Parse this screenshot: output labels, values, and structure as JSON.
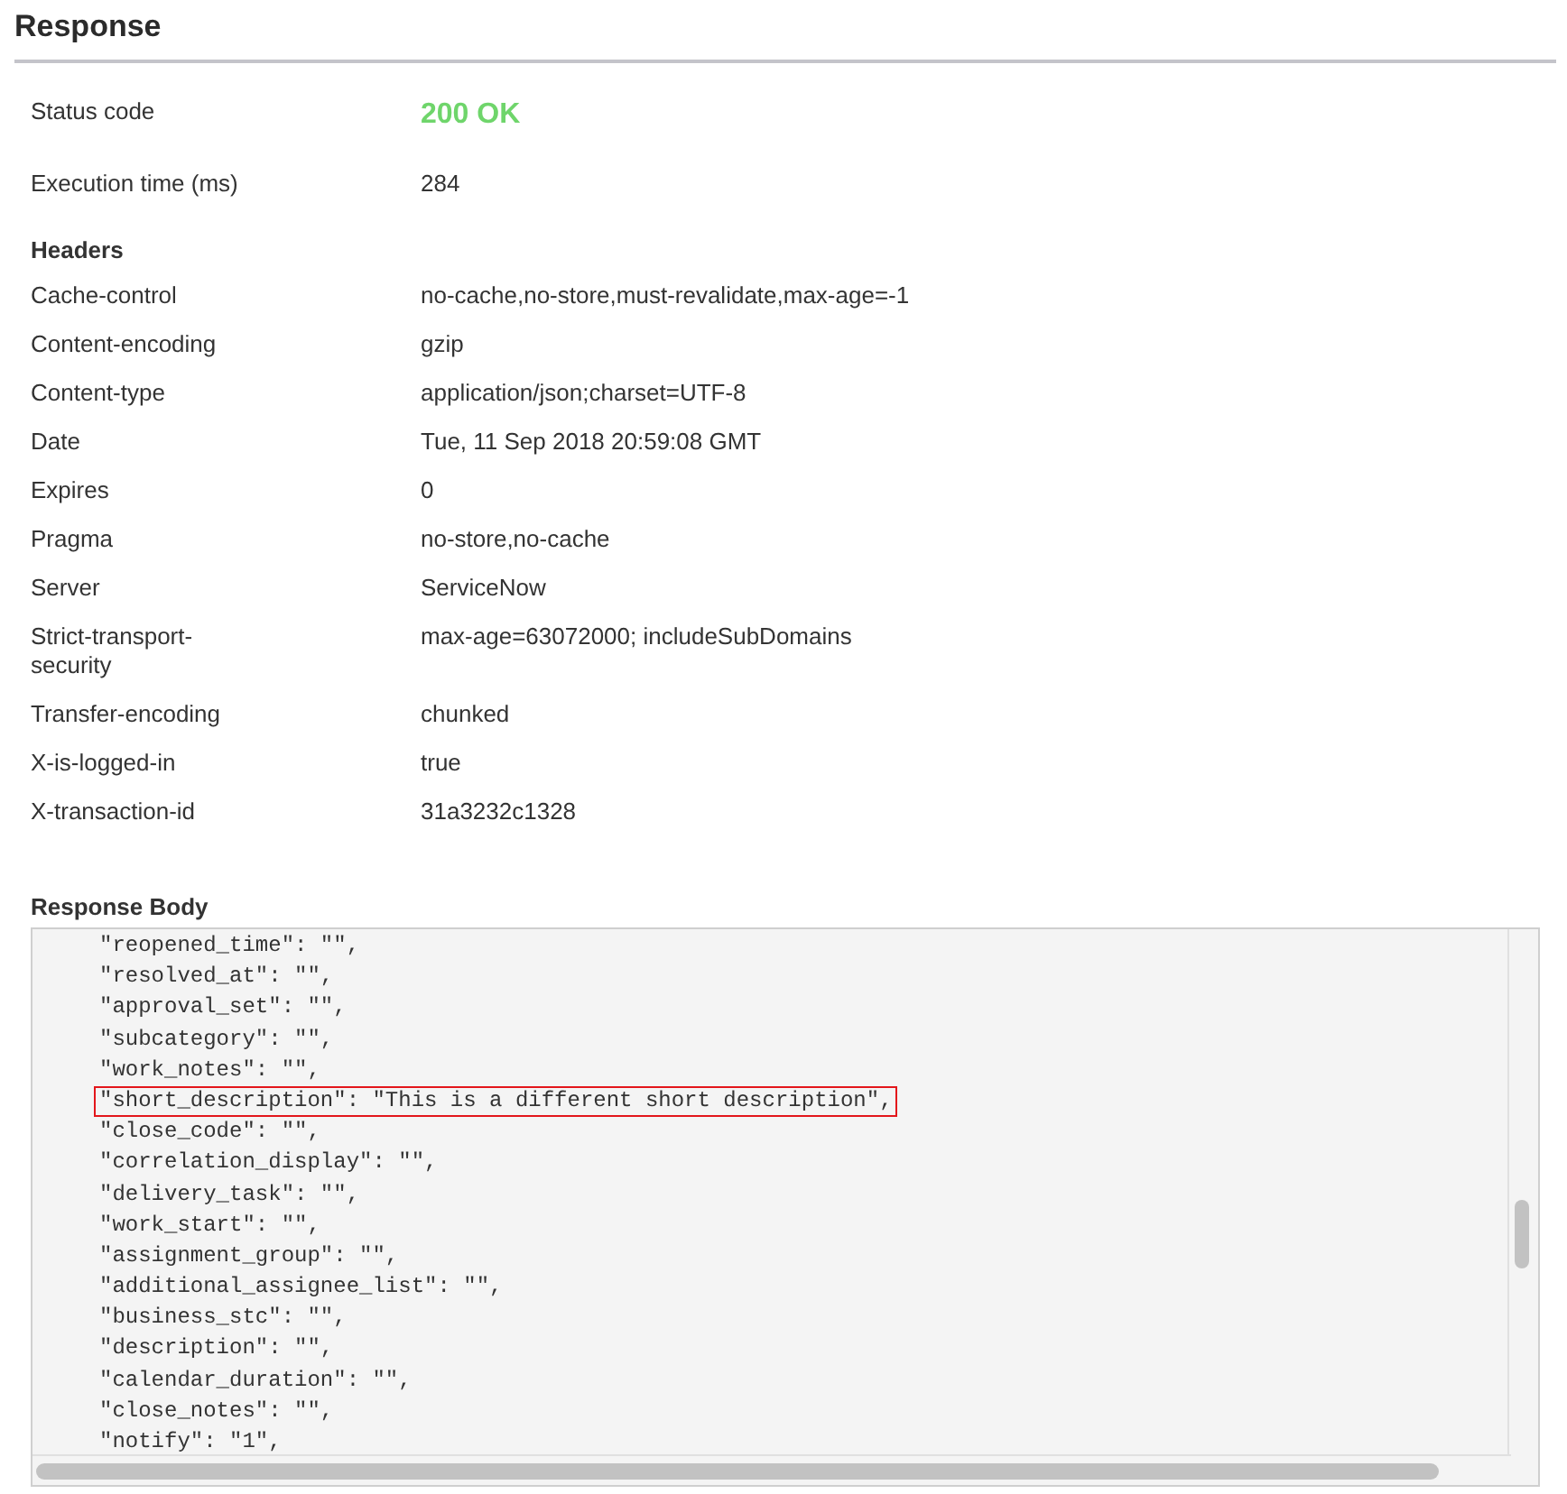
{
  "title": "Response",
  "summary": [
    {
      "label": "Status code",
      "value": "200 OK",
      "kind": "status"
    },
    {
      "label": "Execution time (ms)",
      "value": "284",
      "kind": "plain"
    }
  ],
  "headers_title": "Headers",
  "headers": [
    {
      "name": "Cache-control",
      "value": "no-cache,no-store,must-revalidate,max-age=-1"
    },
    {
      "name": "Content-encoding",
      "value": "gzip"
    },
    {
      "name": "Content-type",
      "value": "application/json;charset=UTF-8"
    },
    {
      "name": "Date",
      "value": "Tue, 11 Sep 2018 20:59:08 GMT"
    },
    {
      "name": "Expires",
      "value": "0"
    },
    {
      "name": "Pragma",
      "value": "no-store,no-cache"
    },
    {
      "name": "Server",
      "value": "ServiceNow"
    },
    {
      "name": "Strict-transport-security",
      "value": "max-age=63072000; includeSubDomains"
    },
    {
      "name": "Transfer-encoding",
      "value": "chunked"
    },
    {
      "name": "X-is-logged-in",
      "value": "true"
    },
    {
      "name": "X-transaction-id",
      "value": "31a3232c1328"
    }
  ],
  "body_title": "Response Body",
  "body_lines": [
    {
      "text": "\"reopened_time\": \"\",",
      "highlighted": false
    },
    {
      "text": "\"resolved_at\": \"\",",
      "highlighted": false
    },
    {
      "text": "\"approval_set\": \"\",",
      "highlighted": false
    },
    {
      "text": "\"subcategory\": \"\",",
      "highlighted": false
    },
    {
      "text": "\"work_notes\": \"\",",
      "highlighted": false
    },
    {
      "text": "\"short_description\": \"This is a different short description\",",
      "highlighted": true
    },
    {
      "text": "\"close_code\": \"\",",
      "highlighted": false
    },
    {
      "text": "\"correlation_display\": \"\",",
      "highlighted": false
    },
    {
      "text": "\"delivery_task\": \"\",",
      "highlighted": false
    },
    {
      "text": "\"work_start\": \"\",",
      "highlighted": false
    },
    {
      "text": "\"assignment_group\": \"\",",
      "highlighted": false
    },
    {
      "text": "\"additional_assignee_list\": \"\",",
      "highlighted": false
    },
    {
      "text": "\"business_stc\": \"\",",
      "highlighted": false
    },
    {
      "text": "\"description\": \"\",",
      "highlighted": false
    },
    {
      "text": "\"calendar_duration\": \"\",",
      "highlighted": false
    },
    {
      "text": "\"close_notes\": \"\",",
      "highlighted": false
    },
    {
      "text": "\"notify\": \"1\",",
      "highlighted": false
    }
  ]
}
